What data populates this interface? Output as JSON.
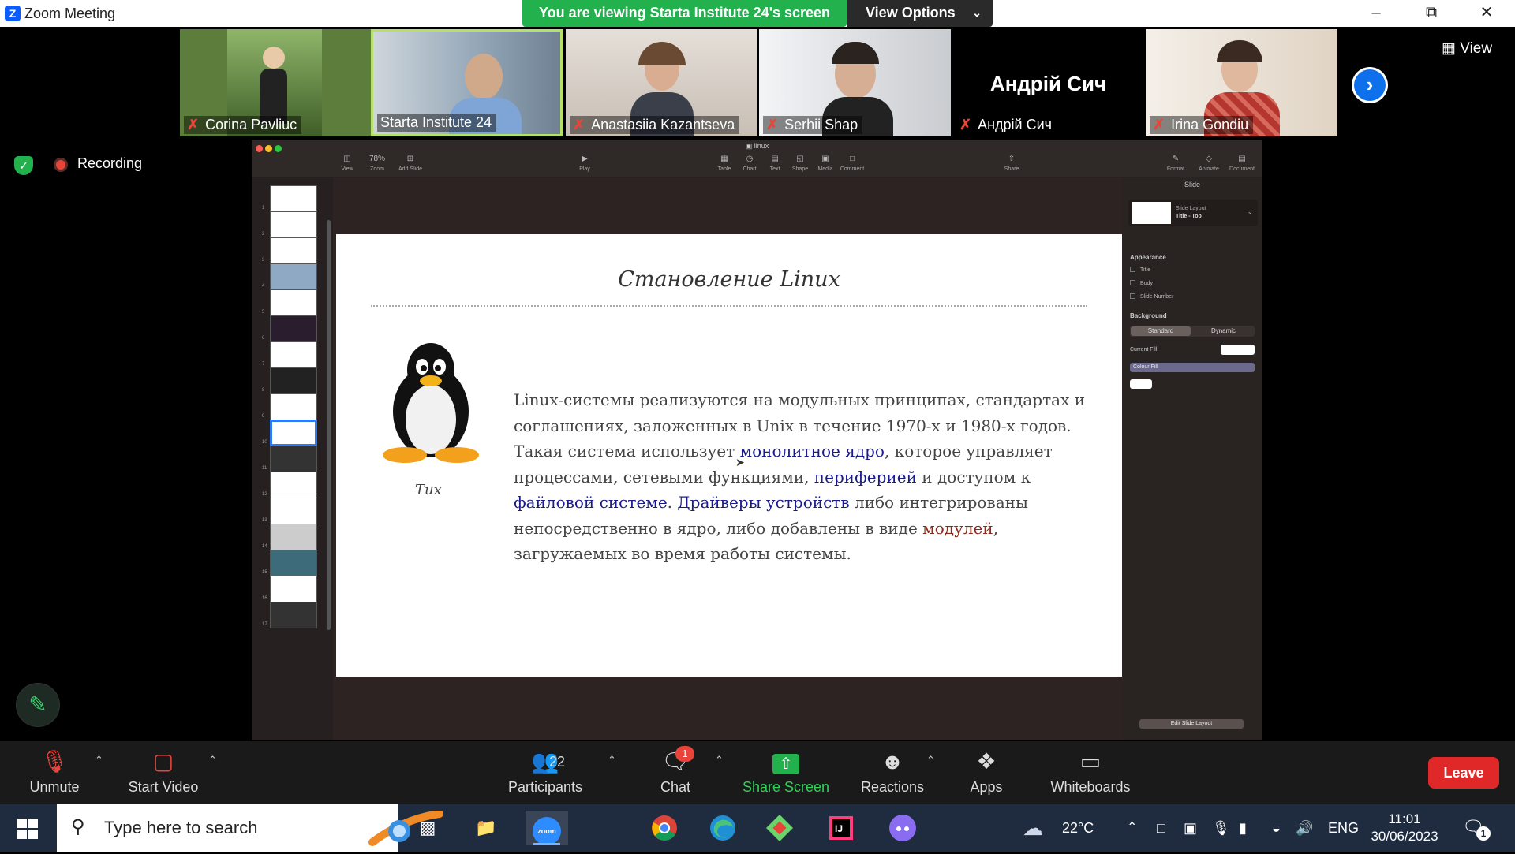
{
  "window": {
    "title": "Zoom Meeting"
  },
  "banner": {
    "text": "You are viewing Starta Institute 24's screen",
    "view_options": "View Options"
  },
  "participants_strip": [
    {
      "name": "Corina Pavliuc",
      "muted": true
    },
    {
      "name": "Starta Institute 24",
      "muted": false,
      "active": true
    },
    {
      "name": "Anastasiia Kazantseva",
      "muted": true
    },
    {
      "name": "Serhii Shap",
      "muted": true
    },
    {
      "name": "Андрій Сич",
      "muted": true,
      "no_video": true,
      "display": "Андрій Сич"
    },
    {
      "name": "Irina Gondiu",
      "muted": true
    }
  ],
  "view_button": "View",
  "recording_label": "Recording",
  "keynote": {
    "doc_name": "linux",
    "zoom": "78%",
    "tools_left": [
      "View",
      "Zoom",
      "Add Slide"
    ],
    "tools_center": [
      "Play"
    ],
    "tools_insert": [
      "Table",
      "Chart",
      "Text",
      "Shape",
      "Media",
      "Comment"
    ],
    "tools_share": "Share",
    "tools_right": [
      "Format",
      "Animate",
      "Document"
    ],
    "slide_numbers": [
      "1",
      "2",
      "3",
      "4",
      "5",
      "6",
      "7",
      "8",
      "9",
      "10",
      "11",
      "12",
      "13",
      "14",
      "15",
      "16",
      "17"
    ],
    "selected_slide": "10",
    "slide": {
      "title": "Становление Linux",
      "image_caption": "Tux",
      "body_1": "Linux-системы реализуются на модульных принципах, стандартах и соглашениях, заложенных в Unix в течение 1970-х и 1980-х годов. Такая система использует ",
      "link_1": "монолитное ядро",
      "body_2": ", которое управляет процессами, сетевыми функциями, ",
      "link_2": "периферией",
      "body_3": " и доступом к ",
      "link_3": "файловой системе",
      "body_4": ". ",
      "link_4": "Драйверы устройств",
      "body_5": " либо интегрированы непосредственно в ядро, либо добавлены в виде ",
      "link_5": "модулей",
      "body_6": ", загружаемых во время работы системы."
    },
    "inspector": {
      "header": "Slide",
      "layout_label": "Slide Layout",
      "layout_value": "Title - Top",
      "appearance": "Appearance",
      "checks": [
        "Title",
        "Body",
        "Slide Number"
      ],
      "background": "Background",
      "seg_standard": "Standard",
      "seg_dynamic": "Dynamic",
      "current_fill": "Current Fill",
      "fill_type": "Colour Fill",
      "edit_layout": "Edit Slide Layout"
    }
  },
  "toolbar": {
    "unmute": "Unmute",
    "start_video": "Start Video",
    "participants": "Participants",
    "participants_count": "22",
    "chat": "Chat",
    "chat_badge": "1",
    "share_screen": "Share Screen",
    "reactions": "Reactions",
    "apps": "Apps",
    "whiteboards": "Whiteboards",
    "leave": "Leave"
  },
  "taskbar": {
    "search_placeholder": "Type here to search",
    "weather": "22°C",
    "language": "ENG",
    "time": "11:01",
    "date": "30/06/2023",
    "notifications": "1"
  },
  "colors": {
    "zoom_blue": "#0b5cff",
    "share_green": "#23b14d",
    "leave_red": "#e02828",
    "taskbar": "#1f2b3e"
  }
}
